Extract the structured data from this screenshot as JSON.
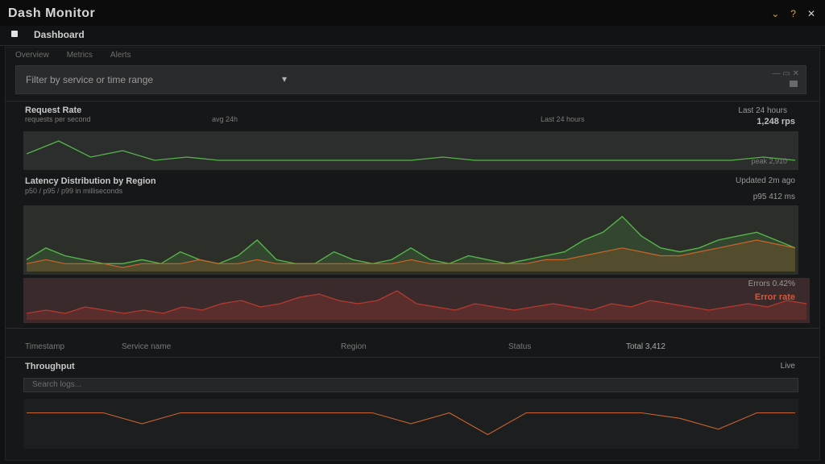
{
  "window": {
    "title": "Dash Monitor",
    "controls": {
      "min": "⌄",
      "help": "?",
      "close": "✕"
    }
  },
  "subheader": {
    "label": "Dashboard"
  },
  "toolbar": {
    "items": [
      "Overview",
      "Metrics",
      "Alerts"
    ]
  },
  "filter": {
    "text": "Filter by service or time range",
    "icon": "filter-icon"
  },
  "section1": {
    "title": "Request Rate",
    "subtitle": "requests per second",
    "mid_label": "avg 24h",
    "right_top": "Last 24 hours",
    "right_strong": "1,248 rps",
    "right_bottom": "peak 2,910"
  },
  "section2": {
    "title": "Latency Distribution by Region",
    "subtitle": "p50 / p95 / p99 in milliseconds",
    "right_top": "Updated 2m ago",
    "right_mid": "p95 412 ms"
  },
  "section3": {
    "right_top": "Errors 0.42%",
    "right_strong": "Error rate"
  },
  "table": {
    "cells": [
      "Timestamp",
      "Service name",
      "Region",
      "Status",
      "Total 3,412"
    ]
  },
  "section4": {
    "title": "Throughput",
    "right": "Live",
    "input_placeholder": "Search logs..."
  },
  "colors": {
    "green": "#55b54a",
    "orange": "#c8642a",
    "red": "#b73a2f",
    "gray": "#8c8c8c"
  },
  "chart_data": [
    {
      "type": "line",
      "title": "Request Rate",
      "x": [
        0,
        1,
        2,
        3,
        4,
        5,
        6,
        7,
        8,
        9,
        10,
        11,
        12,
        13,
        14,
        15,
        16,
        17,
        18,
        19,
        20,
        21,
        22,
        23,
        24
      ],
      "series": [
        {
          "values": [
            4,
            8,
            3,
            5,
            2,
            3,
            2,
            2,
            2,
            2,
            2,
            2,
            2,
            3,
            2,
            2,
            2,
            2,
            2,
            2,
            2,
            2,
            2,
            3,
            2
          ]
        }
      ],
      "ylim": [
        0,
        10
      ]
    },
    {
      "type": "area",
      "title": "Latency Distribution by Region",
      "x": [
        0,
        1,
        2,
        3,
        4,
        5,
        6,
        7,
        8,
        9,
        10,
        11,
        12,
        13,
        14,
        15,
        16,
        17,
        18,
        19,
        20,
        21,
        22,
        23,
        24,
        25,
        26,
        27,
        28,
        29,
        30,
        31,
        32,
        33,
        34,
        35,
        36,
        37,
        38,
        39,
        40
      ],
      "series": [
        {
          "values": [
            3,
            6,
            4,
            3,
            2,
            2,
            3,
            2,
            5,
            3,
            2,
            4,
            8,
            3,
            2,
            2,
            5,
            3,
            2,
            3,
            6,
            3,
            2,
            4,
            3,
            2,
            3,
            4,
            5,
            8,
            10,
            14,
            9,
            6,
            5,
            6,
            8,
            9,
            10,
            8,
            6
          ]
        },
        {
          "values": [
            2,
            3,
            2,
            2,
            2,
            1,
            2,
            2,
            2,
            3,
            2,
            2,
            3,
            2,
            2,
            2,
            2,
            2,
            2,
            2,
            3,
            2,
            2,
            2,
            2,
            2,
            2,
            3,
            3,
            4,
            5,
            6,
            5,
            4,
            4,
            5,
            6,
            7,
            8,
            7,
            6
          ]
        }
      ],
      "ylim": [
        0,
        16
      ]
    },
    {
      "type": "area",
      "title": "Error rate",
      "x": [
        0,
        1,
        2,
        3,
        4,
        5,
        6,
        7,
        8,
        9,
        10,
        11,
        12,
        13,
        14,
        15,
        16,
        17,
        18,
        19,
        20,
        21,
        22,
        23,
        24,
        25,
        26,
        27,
        28,
        29,
        30,
        31,
        32,
        33,
        34,
        35,
        36,
        37,
        38,
        39,
        40
      ],
      "series": [
        {
          "values": [
            2,
            3,
            2,
            4,
            3,
            2,
            3,
            2,
            4,
            3,
            5,
            6,
            4,
            5,
            7,
            8,
            6,
            5,
            6,
            9,
            5,
            4,
            3,
            5,
            4,
            3,
            4,
            5,
            4,
            3,
            5,
            4,
            6,
            5,
            4,
            3,
            4,
            5,
            4,
            6,
            5
          ]
        }
      ],
      "ylim": [
        0,
        12
      ]
    },
    {
      "type": "line",
      "title": "Throughput",
      "x": [
        0,
        1,
        2,
        3,
        4,
        5,
        6,
        7,
        8,
        9,
        10,
        11,
        12,
        13,
        14,
        15,
        16,
        17,
        18,
        19,
        20
      ],
      "series": [
        {
          "values": [
            6,
            6,
            6,
            4,
            6,
            6,
            6,
            6,
            6,
            6,
            4,
            6,
            2,
            6,
            6,
            6,
            6,
            5,
            3,
            6,
            6
          ]
        }
      ],
      "ylim": [
        0,
        8
      ]
    }
  ]
}
